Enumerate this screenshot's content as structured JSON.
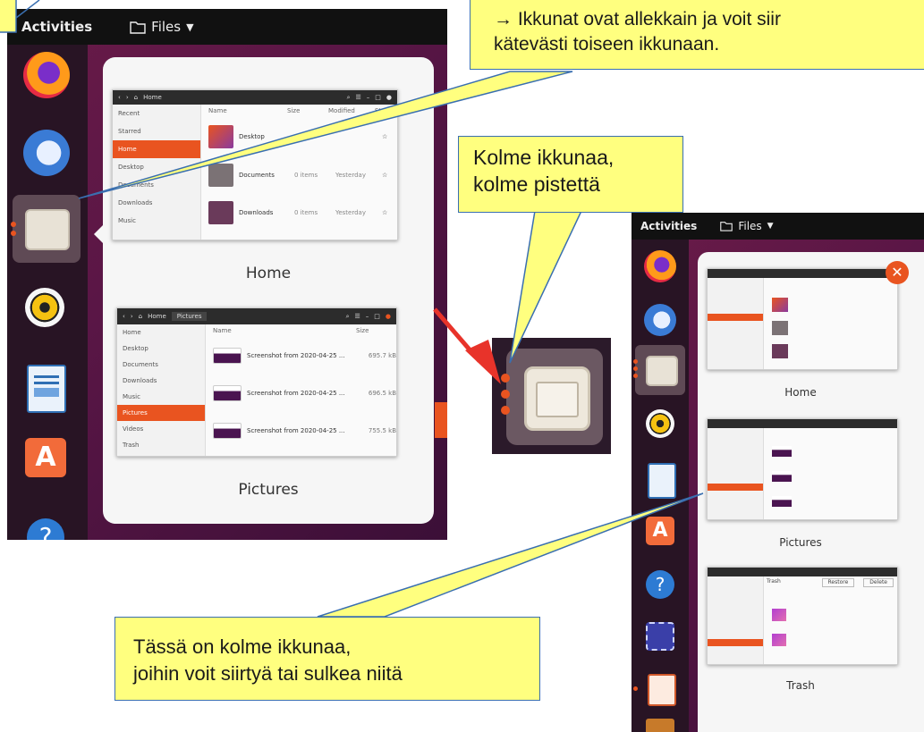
{
  "callouts": {
    "top_line1": "→ Ikkunat ovat allekkain ja voit siir",
    "top_line2": "kätevästi toiseen ikkunaan.",
    "middle_line1": "Kolme ikkunaa,",
    "middle_line2": "kolme pistettä",
    "bottom_line1": "Tässä on kolme ikkunaa,",
    "bottom_line2": "joihin voit siirtyä tai sulkea niitä"
  },
  "left_shot": {
    "topbar": {
      "activities": "Activities",
      "files_menu": "Files"
    },
    "windows": [
      {
        "caption": "Home",
        "path": "Home",
        "sidebar": [
          "Recent",
          "Starred",
          "Home",
          "Desktop",
          "Documents",
          "Downloads",
          "Music"
        ],
        "selected": 2,
        "columns": [
          "Name",
          "Size",
          "Modified",
          "Star"
        ],
        "files": [
          {
            "name": "Desktop",
            "size": "",
            "modified": ""
          },
          {
            "name": "Documents",
            "size": "0 items",
            "modified": "Yesterday"
          },
          {
            "name": "Downloads",
            "size": "0 items",
            "modified": "Yesterday"
          }
        ]
      },
      {
        "caption": "Pictures",
        "path": "Home",
        "path2": "Pictures",
        "sidebar": [
          "Home",
          "Desktop",
          "Documents",
          "Downloads",
          "Music",
          "Pictures",
          "Videos",
          "Trash"
        ],
        "selected": 5,
        "columns": [
          "Name",
          "Size"
        ],
        "files": [
          {
            "name": "Screenshot from 2020-04-25 ...",
            "size": "695.7 kB"
          },
          {
            "name": "Screenshot from 2020-04-25 ...",
            "size": "696.5 kB"
          },
          {
            "name": "Screenshot from 2020-04-25 ...",
            "size": "755.5 kB"
          }
        ]
      }
    ]
  },
  "right_shot": {
    "topbar": {
      "activities": "Activities",
      "files_menu": "Files"
    },
    "windows": [
      {
        "caption": "Home"
      },
      {
        "caption": "Pictures"
      },
      {
        "caption": "Trash",
        "tab1": "Trash",
        "btn1": "Restore",
        "btn2": "Delete"
      }
    ]
  },
  "colors": {
    "accent": "#e95420",
    "callout_bg": "#ffff7f",
    "callout_border": "#3a6fb0",
    "arrow": "#e8332a"
  }
}
